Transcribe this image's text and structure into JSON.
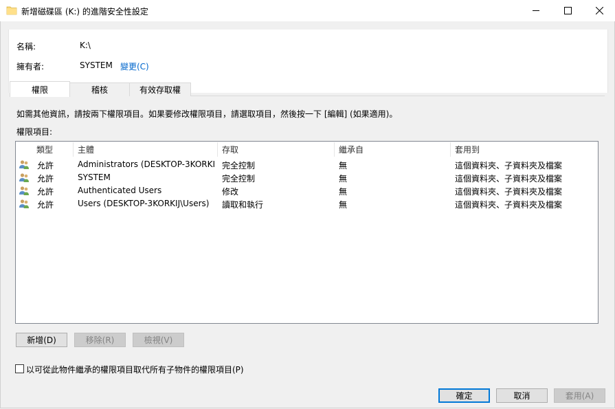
{
  "window": {
    "title": "新增磁碟區 (K:) 的進階安全性設定",
    "minimize_icon": "minimize-icon",
    "maximize_icon": "maximize-icon",
    "close_icon": "close-icon"
  },
  "info": {
    "name_label": "名稱:",
    "name_value": "K:\\",
    "owner_label": "擁有者:",
    "owner_value": "SYSTEM",
    "change_link": "變更(C)"
  },
  "tabs": [
    {
      "label": "權限",
      "active": true
    },
    {
      "label": "稽核",
      "active": false
    },
    {
      "label": "有效存取權",
      "active": false
    }
  ],
  "permissions": {
    "instruction": "如需其他資訊，請按兩下權限項目。如果要修改權限項目，請選取項目，然後按一下 [編輯] (如果適用)。",
    "list_label": "權限項目:",
    "columns": [
      "類型",
      "主體",
      "存取",
      "繼承自",
      "套用到"
    ],
    "rows": [
      {
        "type": "允許",
        "principal": "Administrators (DESKTOP-3KORKI...",
        "access": "完全控制",
        "inherited": "無",
        "applies": "這個資料夾、子資料夾及檔案"
      },
      {
        "type": "允許",
        "principal": "SYSTEM",
        "access": "完全控制",
        "inherited": "無",
        "applies": "這個資料夾、子資料夾及檔案"
      },
      {
        "type": "允許",
        "principal": "Authenticated Users",
        "access": "修改",
        "inherited": "無",
        "applies": "這個資料夾、子資料夾及檔案"
      },
      {
        "type": "允許",
        "principal": "Users (DESKTOP-3KORKIJ\\Users)",
        "access": "讀取和執行",
        "inherited": "無",
        "applies": "這個資料夾、子資料夾及檔案"
      }
    ],
    "add_button": "新增(D)",
    "remove_button": "移除(R)",
    "view_button": "檢視(V)",
    "replace_checkbox_label": "以可從此物件繼承的權限項目取代所有子物件的權限項目(P)",
    "replace_checked": false
  },
  "footer": {
    "ok": "確定",
    "cancel": "取消",
    "apply": "套用(A)"
  },
  "colors": {
    "link": "#0066cc",
    "accent": "#0078d7"
  }
}
